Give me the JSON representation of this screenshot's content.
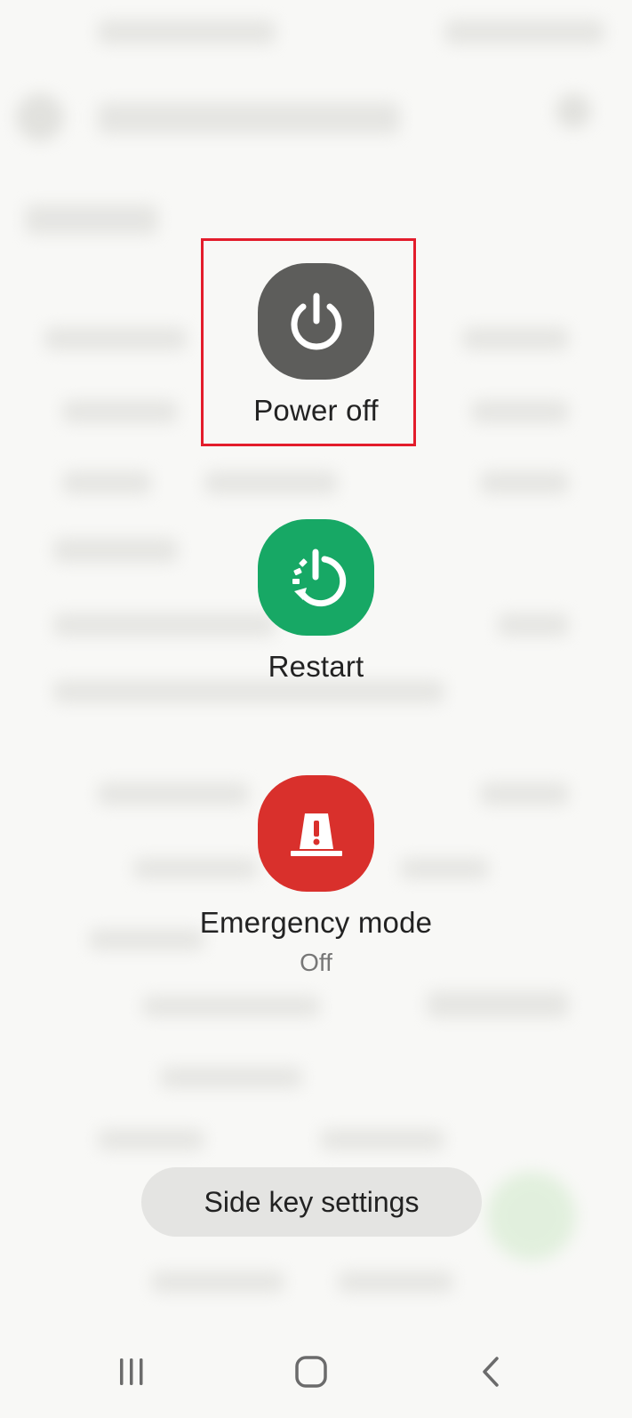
{
  "power_menu": {
    "power_off": {
      "label": "Power off",
      "icon": "power-icon",
      "color": "#5d5d5b"
    },
    "restart": {
      "label": "Restart",
      "icon": "restart-icon",
      "color": "#17a865"
    },
    "emergency": {
      "label": "Emergency mode",
      "status": "Off",
      "icon": "emergency-siren-icon",
      "color": "#d9302c"
    },
    "side_key_settings": {
      "label": "Side key settings"
    },
    "highlight_color": "#e31c2b"
  },
  "navbar": {
    "recents_icon": "recents-icon",
    "home_icon": "home-icon",
    "back_icon": "back-icon"
  }
}
